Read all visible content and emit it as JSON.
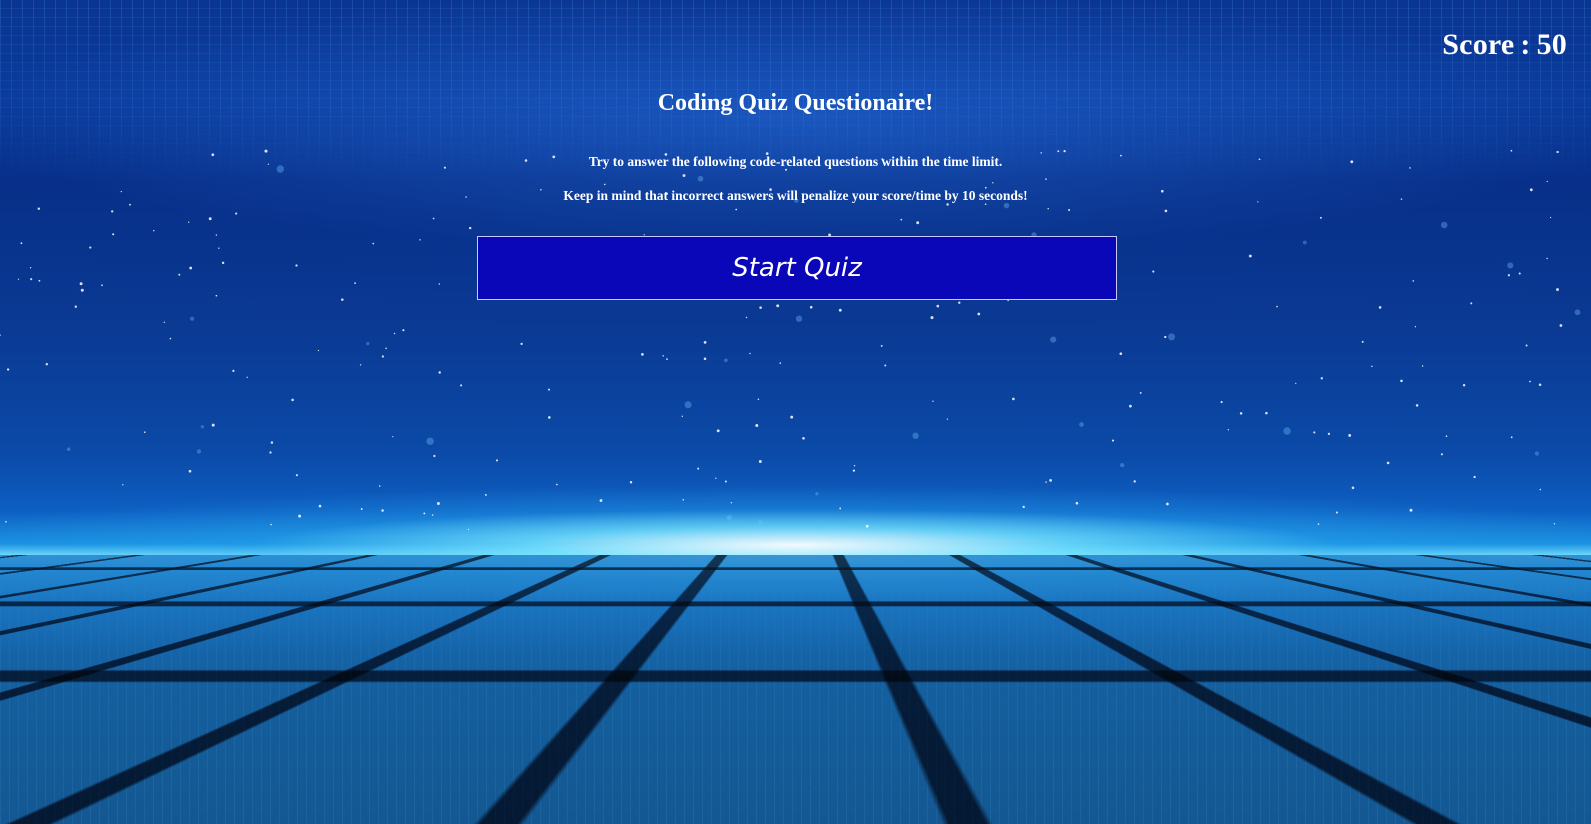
{
  "header": {
    "score_label": "Score",
    "score_separator": ":",
    "score_value": "50"
  },
  "main": {
    "title": "Coding Quiz Questionaire!",
    "instruction_1": "Try to answer the following code-related questions within the time limit.",
    "instruction_2": "Keep in mind that incorrect answers will penalize your score/time by 10 seconds!",
    "start_button_label": "Start Quiz"
  },
  "theme": {
    "button_bg": "#0a07b8",
    "button_border": "#c8c8ff",
    "text_color": "#ffffff",
    "background_top": "#0a3590",
    "horizon_glow": "#7fe4ff",
    "background_bottom": "#06243f"
  }
}
